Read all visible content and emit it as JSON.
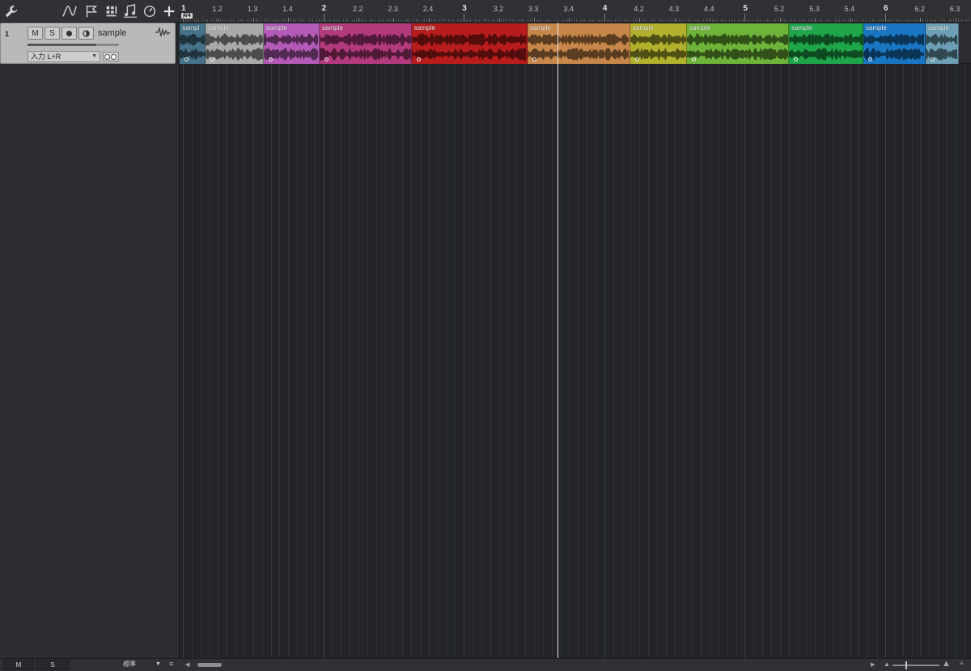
{
  "toolbar": {
    "icons": [
      "wrench-icon",
      "automation-curve-icon",
      "marker-flag-icon",
      "grid-snap-icon",
      "score-icon",
      "tempo-clock-icon",
      "add-track-icon"
    ]
  },
  "ruler": {
    "time_signature": "4/4",
    "labels": [
      "1",
      "1.2",
      "1.3",
      "1.4",
      "2",
      "2.2",
      "2.3",
      "2.4",
      "3",
      "3.2",
      "3.3",
      "3.4",
      "4",
      "4.2",
      "4.3",
      "4.4",
      "5",
      "5.2",
      "5.3",
      "5.4",
      "6",
      "6.2",
      "6.3"
    ]
  },
  "track": {
    "number": "1",
    "mute_label": "M",
    "solo_label": "S",
    "name": "sample",
    "input": "入力 L+R",
    "volume_fraction": 0.75
  },
  "clips": [
    {
      "name": "sampl",
      "color": "#46728a"
    },
    {
      "name": "sample",
      "color": "#a9a9a9"
    },
    {
      "name": "sample",
      "color": "#b35bb6"
    },
    {
      "name": "sample",
      "color": "#b33a7c"
    },
    {
      "name": "sample",
      "color": "#b81c1c"
    },
    {
      "name": "sample",
      "color": "#c8874a"
    },
    {
      "name": "sample",
      "color": "#b1b12e"
    },
    {
      "name": "sample",
      "color": "#6eb43a"
    },
    {
      "name": "sample",
      "color": "#1fa64a"
    },
    {
      "name": "sample",
      "color": "#1976c2"
    },
    {
      "name": "sample",
      "color": "#6d9fb5"
    }
  ],
  "bottom": {
    "mute_label": "M",
    "solo_label": "S",
    "view_mode": "標準"
  }
}
